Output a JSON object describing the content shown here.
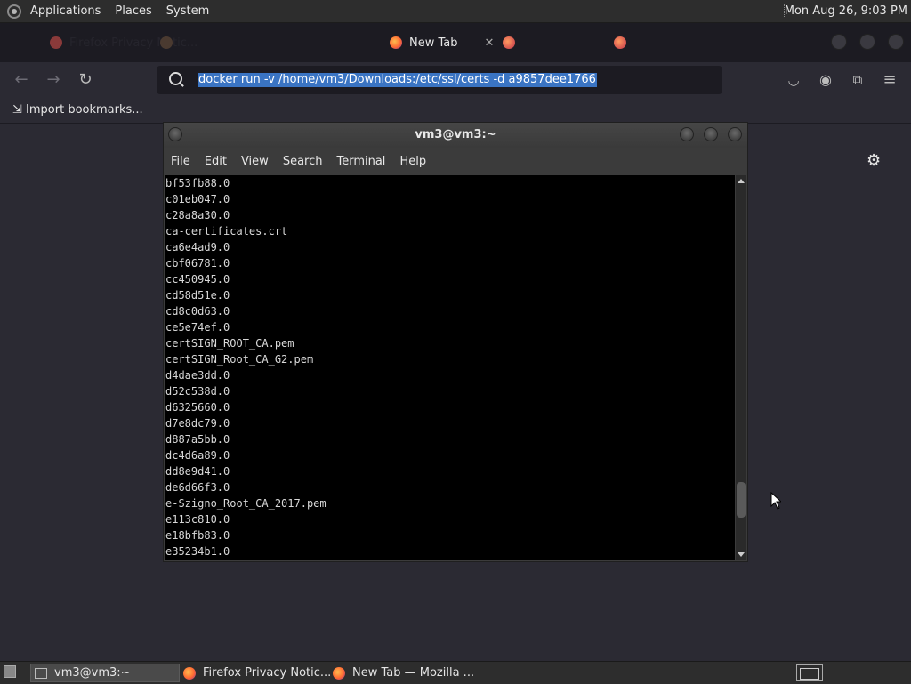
{
  "top_panel": {
    "applications": "Applications",
    "places": "Places",
    "system": "System",
    "clock": "Mon Aug 26,  9:03 PM"
  },
  "browser": {
    "tabs": [
      {
        "label": "Firefox Privacy Notic...",
        "active": false
      },
      {
        "label": "",
        "active": false
      },
      {
        "label": "",
        "active": false
      },
      {
        "label": "New Tab",
        "active": true
      },
      {
        "label": "",
        "active": false
      },
      {
        "label": "",
        "active": false
      }
    ],
    "active_tab_label": "New Tab",
    "url": "docker run -v /home/vm3/Downloads:/etc/ssl/certs -d a9857dee1766",
    "bookmarks_import": "Import bookmarks..."
  },
  "terminal": {
    "title": "vm3@vm3:~",
    "menu": [
      "File",
      "Edit",
      "View",
      "Search",
      "Terminal",
      "Help"
    ],
    "lines": [
      "bf53fb88.0",
      "c01eb047.0",
      "c28a8a30.0",
      "ca-certificates.crt",
      "ca6e4ad9.0",
      "cbf06781.0",
      "cc450945.0",
      "cd58d51e.0",
      "cd8c0d63.0",
      "ce5e74ef.0",
      "certSIGN_ROOT_CA.pem",
      "certSIGN_Root_CA_G2.pem",
      "d4dae3dd.0",
      "d52c538d.0",
      "d6325660.0",
      "d7e8dc79.0",
      "d887a5bb.0",
      "dc4d6a89.0",
      "dd8e9d41.0",
      "de6d66f3.0",
      "e-Szigno_Root_CA_2017.pem",
      "e113c810.0",
      "e18bfb83.0",
      "e35234b1.0"
    ]
  },
  "taskbar": {
    "items": [
      {
        "label": "vm3@vm3:~",
        "icon": "terminal-icon",
        "active": true
      },
      {
        "label": "Firefox Privacy Notic...",
        "icon": "firefox-icon",
        "active": false
      },
      {
        "label": "New Tab — Mozilla ...",
        "icon": "firefox-icon",
        "active": false
      }
    ]
  },
  "colors": {
    "panel": "#2d2d2d",
    "browser_bg": "#2b2a33",
    "url_highlight": "#3a74c3",
    "terminal_bg": "#000000"
  }
}
